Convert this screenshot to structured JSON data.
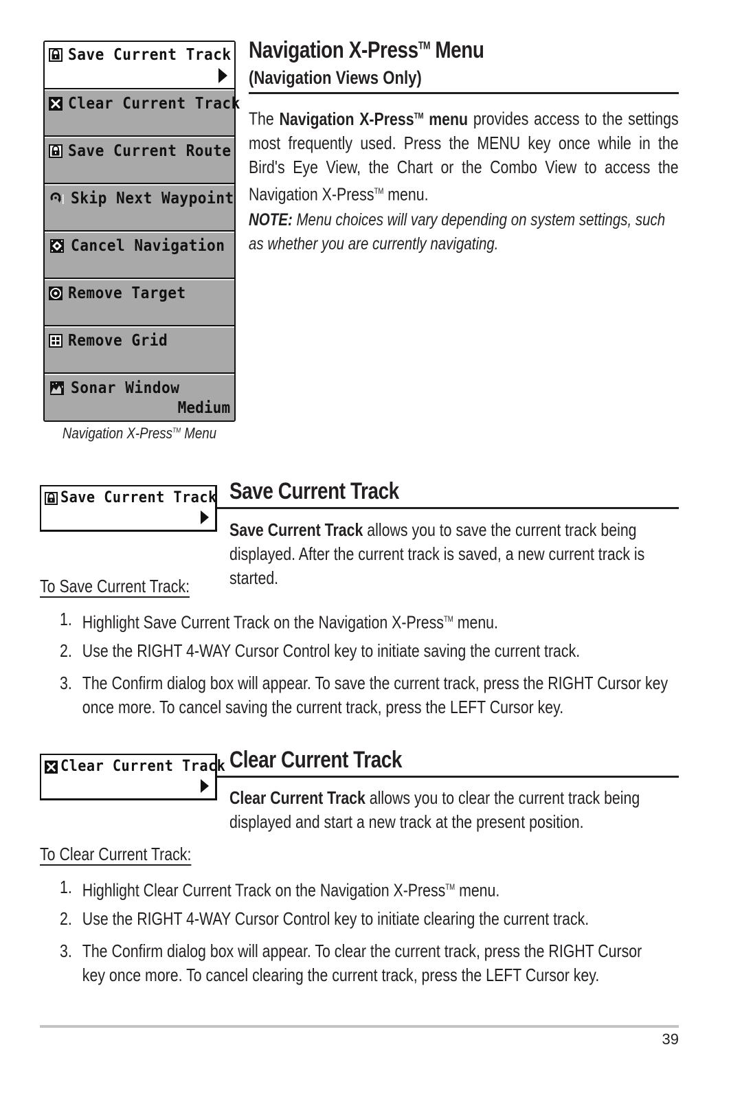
{
  "menu": {
    "items": [
      {
        "icon": "lock-save-icon",
        "label": "Save Current Track",
        "value": "",
        "selected": true,
        "has_arrow": true
      },
      {
        "icon": "x-clear-icon",
        "label": "Clear Current Track",
        "value": "",
        "selected": false,
        "has_arrow": false
      },
      {
        "icon": "lock-save-icon",
        "label": "Save Current Route",
        "value": "",
        "selected": false,
        "has_arrow": false
      },
      {
        "icon": "skip-waypoint-icon",
        "label": "Skip Next Waypoint",
        "value": "",
        "selected": false,
        "has_arrow": false
      },
      {
        "icon": "cancel-navigation-icon",
        "label": "Cancel Navigation",
        "value": "",
        "selected": false,
        "has_arrow": false
      },
      {
        "icon": "target-icon",
        "label": "Remove Target",
        "value": "",
        "selected": false,
        "has_arrow": false
      },
      {
        "icon": "grid-icon",
        "label": "Remove Grid",
        "value": "",
        "selected": false,
        "has_arrow": false
      },
      {
        "icon": "sonar-window-icon",
        "label": "Sonar Window",
        "value": "Medium",
        "selected": false,
        "has_arrow": false
      }
    ],
    "caption": "Navigation X-Press",
    "caption_tm": "TM",
    "caption_suffix": " Menu"
  },
  "intro": {
    "title": "Navigation X-Press",
    "title_tm": "TM",
    "title_suffix": " Menu",
    "subtitle": "(Navigation Views Only)",
    "para_lead": "The ",
    "para_bold": "Navigation X-Press",
    "para_bold_tm": "TM",
    "para_bold_suffix": " menu",
    "para_rest": " provides access to the settings most frequently used.  Press the MENU key once while in the Bird's Eye View, the Chart or the Combo View to access the Navigation X-Press",
    "para_tm": "TM",
    "para_end": " menu.",
    "note_label": "NOTE:",
    "note_text": "  Menu choices will vary depending on system settings, such as whether you are currently navigating."
  },
  "save_track": {
    "box_label": "Save Current Track",
    "heading": "Save Current Track",
    "desc_bold": "Save Current Track",
    "desc_rest": " allows you to save the current track being displayed. After the current track is saved, a new current track is started.",
    "subhead": "To Save Current Track:",
    "steps": [
      {
        "num": "1.",
        "text": "Highlight Save Current Track on the Navigation X-Press",
        "tm": "TM",
        "end": " menu."
      },
      {
        "num": "2.",
        "text": "Use the RIGHT 4-WAY Cursor Control key to initiate saving the current track.",
        "tm": "",
        "end": ""
      },
      {
        "num": "3.",
        "text": "The Confirm dialog box will appear. To save the current track,  press the RIGHT Cursor key once more. To cancel saving the current track, press the LEFT Cursor key.",
        "tm": "",
        "end": ""
      }
    ]
  },
  "clear_track": {
    "box_label": "Clear Current Track",
    "heading": "Clear Current Track",
    "desc_bold": "Clear Current Track",
    "desc_rest": " allows you to clear the current track being displayed and start a new track at the present position.",
    "subhead": "To Clear Current Track:",
    "steps": [
      {
        "num": "1.",
        "text": "Highlight Clear Current Track on the Navigation X-Press",
        "tm": "TM",
        "end": " menu."
      },
      {
        "num": "2.",
        "text": "Use the RIGHT 4-WAY Cursor Control key to initiate clearing the current track.",
        "tm": "",
        "end": ""
      },
      {
        "num": "3.",
        "text": "The Confirm dialog box will appear. To clear the current track,  press the RIGHT Cursor key once more. To cancel clearing the current track, press the LEFT Cursor key.",
        "tm": "",
        "end": ""
      }
    ]
  },
  "footer": {
    "page_number": "39"
  }
}
